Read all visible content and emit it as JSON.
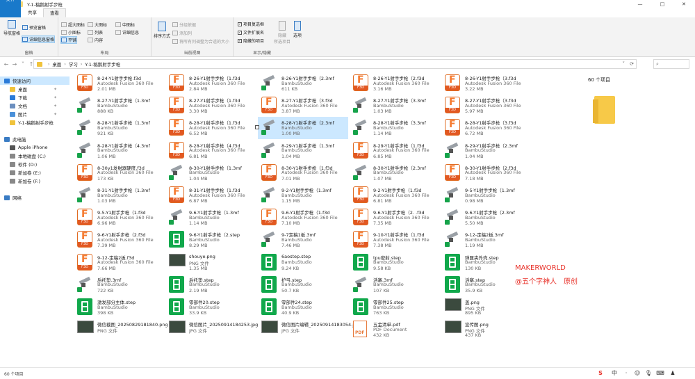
{
  "window": {
    "title": "Y-1-稿鹅射手步枪",
    "minimize": "—",
    "maximize": "□",
    "close": "✕"
  },
  "tabs": [
    {
      "label": "文件"
    },
    {
      "label": "主页"
    },
    {
      "label": "共享"
    },
    {
      "label": "查看"
    }
  ],
  "ribbon": {
    "pane": {
      "nav_pane": "导航窗格",
      "preview": "预览窗格",
      "details": "详细信息窗格",
      "label": "窗格"
    },
    "layout": {
      "xl_icons": "超大图标",
      "large_icons": "大图标",
      "medium_icons": "中图标",
      "small_icons": "小图标",
      "list": "列表",
      "details": "详细信息",
      "tiles": "平铺",
      "content": "内容",
      "label": "布局"
    },
    "view": {
      "sort": "排序方式",
      "group_by": "分组依据",
      "add_columns": "添加列",
      "fit_columns": "将所有列调整为合适的大小",
      "label": "当前视图"
    },
    "show": {
      "checkboxes": "项目复选框",
      "extensions": "文件扩展名",
      "hidden": "隐藏的项目",
      "hide_selected": "隐藏",
      "hide_selected2": "所选项目",
      "options": "选项",
      "label": "显示/隐藏"
    }
  },
  "breadcrumb": [
    "桌面",
    "学习",
    "Y-1-稿鹅射手步枪"
  ],
  "sidebar": [
    {
      "label": "快速访问",
      "type": "star",
      "indent": 0,
      "selected": true
    },
    {
      "label": "桌面",
      "type": "folder",
      "indent": 1,
      "pin": true
    },
    {
      "label": "下载",
      "type": "download",
      "indent": 1,
      "pin": true
    },
    {
      "label": "文档",
      "type": "doc",
      "indent": 1,
      "pin": true
    },
    {
      "label": "图片",
      "type": "pic",
      "indent": 1,
      "pin": true
    },
    {
      "label": "Y-1-稿鹅射手步枪",
      "type": "folder",
      "indent": 1
    },
    {
      "label": "",
      "type": "none",
      "indent": 0
    },
    {
      "label": "此电脑",
      "type": "pc",
      "indent": 0
    },
    {
      "label": "Apple iPhone",
      "type": "phone",
      "indent": 1
    },
    {
      "label": "本地磁盘 (C:)",
      "type": "drive",
      "indent": 1
    },
    {
      "label": "软件 (D:)",
      "type": "drive",
      "indent": 1
    },
    {
      "label": "新加卷 (E:)",
      "type": "drive",
      "indent": 1
    },
    {
      "label": "新加卷 (F:)",
      "type": "drive",
      "indent": 1
    },
    {
      "label": "",
      "type": "none",
      "indent": 0
    },
    {
      "label": "网络",
      "type": "net",
      "indent": 0
    }
  ],
  "files": [
    {
      "name": "8-24-Y1射手步枪.f3d",
      "type": "Autodesk Fusion 360 File",
      "size": "2.01 MB",
      "icon": "f3d"
    },
    {
      "name": "8-26-Y1射手步枪（1.f3d",
      "type": "Autodesk Fusion 360 File",
      "size": "2.84 MB",
      "icon": "f3d"
    },
    {
      "name": "8-26-Y1射手步枪（2.3mf",
      "type": "BambuStudio",
      "size": "611 KB",
      "icon": "part"
    },
    {
      "name": "8-26-Y1射手步枪（2.f3d",
      "type": "Autodesk Fusion 360 File",
      "size": "3.16 MB",
      "icon": "f3d"
    },
    {
      "name": "8-26-Y1射手步枪（3.f3d",
      "type": "Autodesk Fusion 360 File",
      "size": "3.22 MB",
      "icon": "f3d"
    },
    {
      "name": "8-27-Y1射手步枪（1.3mf",
      "type": "BambuStudio",
      "size": "888 KB",
      "icon": "part"
    },
    {
      "name": "8-27-Y1射手步枪（1.f3d",
      "type": "Autodesk Fusion 360 File",
      "size": "3.30 MB",
      "icon": "f3d"
    },
    {
      "name": "8-27-Y1射手步枪（3.f3d",
      "type": "Autodesk Fusion 360 File",
      "size": "3.87 MB",
      "icon": "f3d"
    },
    {
      "name": "8-27-Y1射手步枪（3.3mf",
      "type": "BambuStudio",
      "size": "1.03 MB",
      "icon": "part"
    },
    {
      "name": "8-27-Y1射手步枪（3.f3d",
      "type": "Autodesk Fusion 360 File",
      "size": "5.97 MB",
      "icon": "f3d"
    },
    {
      "name": "8-28-Y1射手步枪（1.3mf",
      "type": "BambuStudio",
      "size": "921 KB",
      "icon": "part"
    },
    {
      "name": "8-28-Y1射手步枪（1.f3d",
      "type": "Autodesk Fusion 360 File",
      "size": "6.52 MB",
      "icon": "f3d"
    },
    {
      "name": "8-28-Y1射手步枪（2.3mf",
      "type": "BambuStudio",
      "size": "1.00 MB",
      "icon": "part",
      "selected": true
    },
    {
      "name": "8-28-Y1射手步枪（3.3mf",
      "type": "BambuStudio",
      "size": "1.14 MB",
      "icon": "part"
    },
    {
      "name": "8-28-Y1射手步枪（3.f3d",
      "type": "Autodesk Fusion 360 File",
      "size": "6.72 MB",
      "icon": "f3d"
    },
    {
      "name": "8-28-Y1射手步枪（4.3mf",
      "type": "BambuStudio",
      "size": "1.06 MB",
      "icon": "part"
    },
    {
      "name": "8-28-Y1射手步枪（4.f3d",
      "type": "Autodesk Fusion 360 File",
      "size": "6.81 MB",
      "icon": "f3d"
    },
    {
      "name": "8-29-Y1射手步枪（1.3mf",
      "type": "BambuStudio",
      "size": "1.04 MB",
      "icon": "part"
    },
    {
      "name": "8-29-Y1射手步枪（1.f3d",
      "type": "Autodesk Fusion 360 File",
      "size": "6.85 MB",
      "icon": "f3d"
    },
    {
      "name": "8-29-Y1射手步枪（2.3mf",
      "type": "BambuStudio",
      "size": "1.04 MB",
      "icon": "part"
    },
    {
      "name": "8-30y1发射器硬度.f3d",
      "type": "Autodesk Fusion 360 File",
      "size": "173 KB",
      "icon": "f3d"
    },
    {
      "name": "8-30-Y1射手步枪（1.3mf",
      "type": "BambuStudio",
      "size": "1.04 MB",
      "icon": "part"
    },
    {
      "name": "8-30-Y1射手步枪（1.f3d",
      "type": "Autodesk Fusion 360 File",
      "size": "7.01 MB",
      "icon": "f3d"
    },
    {
      "name": "8-30-Y1射手步枪（2.3mf",
      "type": "BambuStudio",
      "size": "1.07 MB",
      "icon": "part"
    },
    {
      "name": "8-30-Y1射手步枪（2.f3d",
      "type": "Autodesk Fusion 360 File",
      "size": "7.18 MB",
      "icon": "f3d"
    },
    {
      "name": "8-31-Y1射手步枪（1.3mf",
      "type": "BambuStudio",
      "size": "1.03 MB",
      "icon": "part"
    },
    {
      "name": "8-31-Y1射手步枪（1.f3d",
      "type": "Autodesk Fusion 360 File",
      "size": "6.87 MB",
      "icon": "f3d"
    },
    {
      "name": "9-2-Y1射手步枪（1.3mf",
      "type": "BambuStudio",
      "size": "1.15 MB",
      "icon": "part"
    },
    {
      "name": "9-2-Y1射手步枪（1.f3d",
      "type": "Autodesk Fusion 360 File",
      "size": "6.81 MB",
      "icon": "f3d"
    },
    {
      "name": "9-5-Y1射手步枪（1.3mf",
      "type": "BambuStudio",
      "size": "0.98 MB",
      "icon": "part"
    },
    {
      "name": "9-5-Y1射手步枪（1.f3d",
      "type": "Autodesk Fusion 360 File",
      "size": "6.96 MB",
      "icon": "f3d"
    },
    {
      "name": "9-6-Y1射手步枪（1.3mf",
      "type": "BambuStudio",
      "size": "1.14 MB",
      "icon": "part"
    },
    {
      "name": "9-6-Y1射手步枪（1.f3d",
      "type": "Autodesk Fusion 360 File",
      "size": "7.10 MB",
      "icon": "f3d"
    },
    {
      "name": "9-6-Y1射手步枪（2.  .f3d",
      "type": "Autodesk Fusion 360 File",
      "size": "7.35 MB",
      "icon": "f3d"
    },
    {
      "name": "9-6-Y1射手步枪（2.3mf",
      "type": "BambuStudio",
      "size": "5.50 MB",
      "icon": "part"
    },
    {
      "name": "9-6-Y1射手步枪（2.f3d",
      "type": "Autodesk Fusion 360 File",
      "size": "7.39 MB",
      "icon": "f3d"
    },
    {
      "name": "9-6-Y1射手步枪（2.step",
      "type": "BambuStudio",
      "size": "8.29 MB",
      "icon": "step"
    },
    {
      "name": "9-7定稿1板.3mf",
      "type": "BambuStudio",
      "size": "7.46 MB",
      "icon": "part"
    },
    {
      "name": "9-10-Y1射手步枪（1.f3d",
      "type": "Autodesk Fusion 360 File",
      "size": "7.38 MB",
      "icon": "f3d"
    },
    {
      "name": "9-12-定稿2板.3mf",
      "type": "BambuStudio",
      "size": "1.19 MB",
      "icon": "part"
    },
    {
      "name": "9-12-定稿2板.f3d",
      "type": "Autodesk Fusion 360 File",
      "size": "7.66 MB",
      "icon": "f3d"
    },
    {
      "name": "shouye.png",
      "type": "PNG 文件",
      "size": "1.35 MB",
      "icon": "img"
    },
    {
      "name": "6aostep.step",
      "type": "BambuStudio",
      "size": "9.24 KB",
      "icon": "step"
    },
    {
      "name": "tpu密封.step",
      "type": "BambuStudio",
      "size": "9.58 KB",
      "icon": "step"
    },
    {
      "name": "弹匣夹外壳.step",
      "type": "BambuStudio",
      "size": "130 KB",
      "icon": "step"
    },
    {
      "name": "后托垫.3mf",
      "type": "BambuStudio",
      "size": "722 KB",
      "icon": "part"
    },
    {
      "name": "后托垫.step",
      "type": "BambuStudio",
      "size": "2.19 MB",
      "icon": "step"
    },
    {
      "name": "护弓.step",
      "type": "BambuStudio",
      "size": "50.7 KB",
      "icon": "step"
    },
    {
      "name": "活塞.3mf",
      "type": "BambuStudio",
      "size": "107 KB",
      "icon": "part"
    },
    {
      "name": "活塞.step",
      "type": "BambuStudio",
      "size": "35.9 KB",
      "icon": "step"
    },
    {
      "name": "激发部分主体.step",
      "type": "BambuStudio",
      "size": "398 KB",
      "icon": "step"
    },
    {
      "name": "零部件20.step",
      "type": "BambuStudio",
      "size": "33.9 KB",
      "icon": "step"
    },
    {
      "name": "零部件24.step",
      "type": "BambuStudio",
      "size": "40.9 KB",
      "icon": "step"
    },
    {
      "name": "零部件25.step",
      "type": "BambuStudio",
      "size": "763 KB",
      "icon": "step"
    },
    {
      "name": "盖.png",
      "type": "PNG 文件",
      "size": "895 KB",
      "icon": "img"
    },
    {
      "name": "微信截图_20250829181840.png",
      "type": "PNG 文件",
      "size": "",
      "icon": "img"
    },
    {
      "name": "微信图片_20250914184253.jpg",
      "type": "JPG 文件",
      "size": "",
      "icon": "img"
    },
    {
      "name": "微信图片编辑_20250914183054.jpg",
      "type": "JPG 文件",
      "size": "",
      "icon": "img"
    },
    {
      "name": "五金清单.pdf",
      "type": "PDF Document",
      "size": "432 KB",
      "icon": "pdf"
    },
    {
      "name": "宣传图.png",
      "type": "PNG 文件",
      "size": "437 KB",
      "icon": "img"
    }
  ],
  "preview": {
    "count": "60 个项目"
  },
  "watermark": {
    "line1": "MAKERWORLD",
    "line2": "@五个字神人　原创"
  },
  "status": {
    "count": "60 个项目"
  },
  "tray": [
    "S",
    "中",
    "·",
    "☺",
    "🎙",
    "⌨",
    "♟"
  ]
}
